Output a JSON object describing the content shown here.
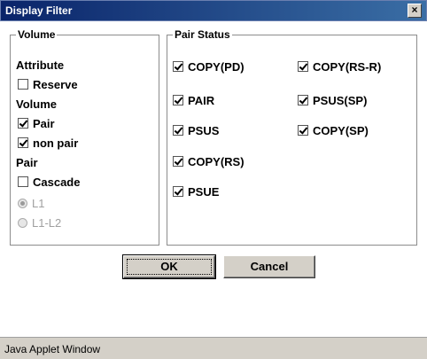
{
  "window": {
    "title": "Display Filter",
    "close_glyph": "×"
  },
  "volume_group": {
    "legend": "Volume",
    "attribute_header": "Attribute",
    "reserve": {
      "label": "Reserve",
      "checked": false
    },
    "volume_header": "Volume",
    "pair": {
      "label": "Pair",
      "checked": true
    },
    "non_pair": {
      "label": "non pair",
      "checked": true
    },
    "pair_header": "Pair",
    "cascade": {
      "label": "Cascade",
      "checked": false
    },
    "l1": {
      "label": "L1",
      "selected": true,
      "enabled": false
    },
    "l1_l2": {
      "label": "L1-L2",
      "selected": false,
      "enabled": false
    }
  },
  "pair_status_group": {
    "legend": "Pair Status",
    "items": [
      {
        "label": "COPY(PD)",
        "checked": true
      },
      {
        "label": "PAIR",
        "checked": true
      },
      {
        "label": "PSUS",
        "checked": true
      },
      {
        "label": "COPY(RS)",
        "checked": true
      },
      {
        "label": "PSUE",
        "checked": true
      },
      {
        "label": "COPY(RS-R)",
        "checked": true
      },
      {
        "label": "PSUS(SP)",
        "checked": true
      },
      {
        "label": "COPY(SP)",
        "checked": true
      }
    ]
  },
  "buttons": {
    "ok": "OK",
    "cancel": "Cancel"
  },
  "status_bar": {
    "text": "Java Applet Window"
  }
}
